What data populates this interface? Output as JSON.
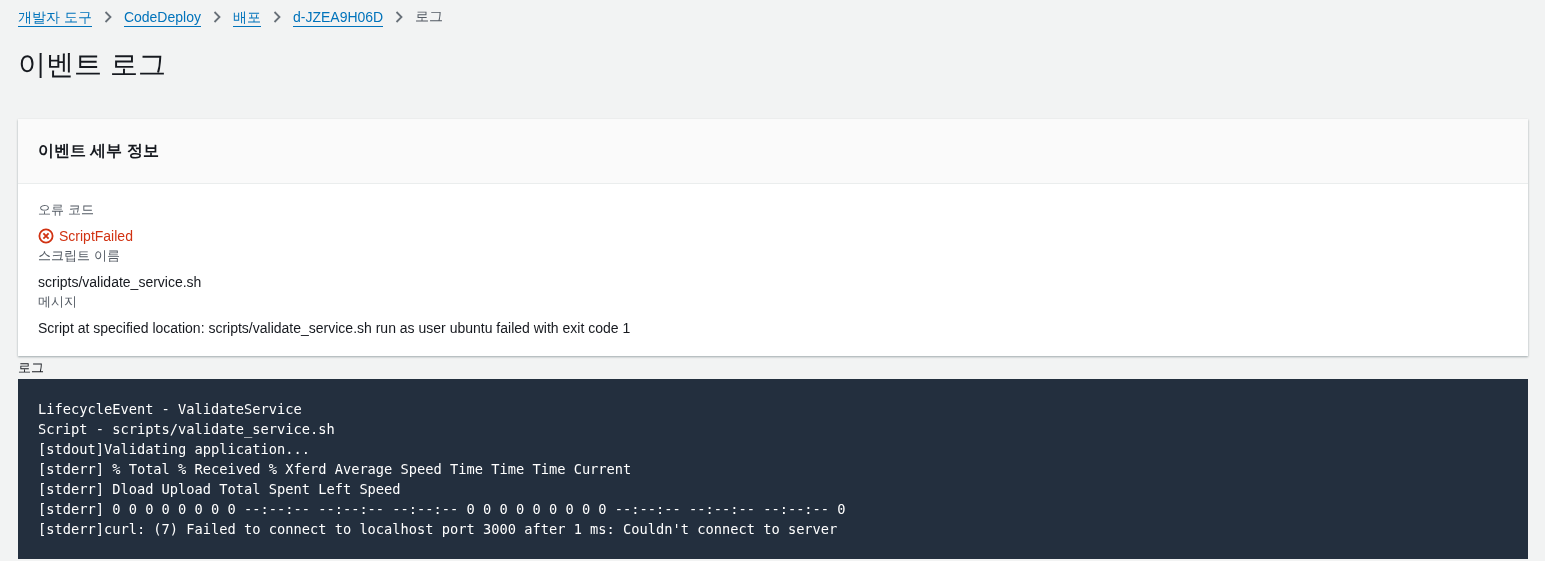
{
  "breadcrumbs": [
    {
      "label": "개발자 도구",
      "kind": "link"
    },
    {
      "label": "CodeDeploy",
      "kind": "link"
    },
    {
      "label": "배포",
      "kind": "link"
    },
    {
      "label": "d-JZEA9H06D",
      "kind": "link"
    },
    {
      "label": "로그",
      "kind": "current"
    }
  ],
  "page_title": "이벤트 로그",
  "details": {
    "title": "이벤트 세부 정보",
    "fields": [
      {
        "label": "오류 코드",
        "value": "ScriptFailed",
        "kind": "error"
      },
      {
        "label": "스크립트 이름",
        "value": "scripts/validate_service.sh",
        "kind": "text"
      },
      {
        "label": "메시지",
        "value": "Script at specified location: scripts/validate_service.sh run as user ubuntu failed with exit code 1",
        "kind": "text"
      }
    ]
  },
  "log": {
    "label": "로그",
    "lines": [
      "LifecycleEvent - ValidateService",
      "Script - scripts/validate_service.sh",
      "[stdout]Validating application...",
      "[stderr] % Total % Received % Xferd Average Speed Time Time Time Current",
      "[stderr] Dload Upload Total Spent Left Speed",
      "[stderr] 0 0 0 0 0 0 0 0 --:--:-- --:--:-- --:--:-- 0 0 0 0 0 0 0 0 0 --:--:-- --:--:-- --:--:-- 0",
      "[stderr]curl: (7) Failed to connect to localhost port 3000 after 1 ms: Couldn't connect to server"
    ]
  }
}
